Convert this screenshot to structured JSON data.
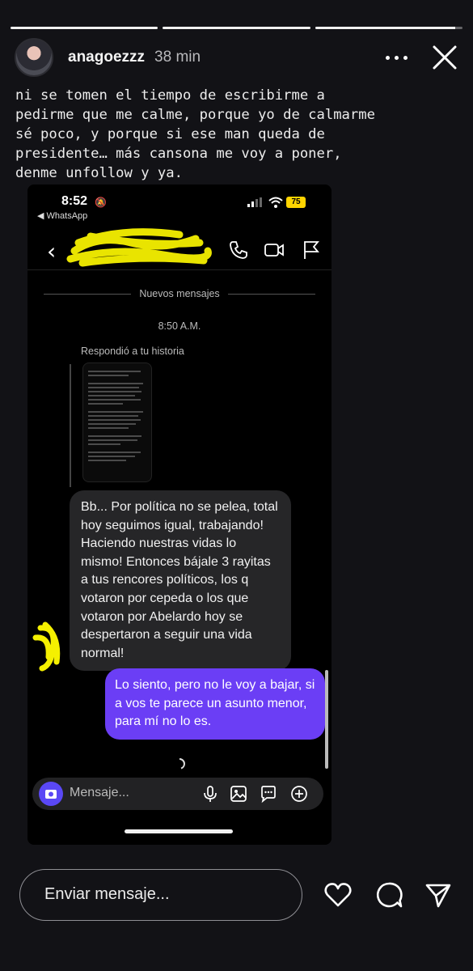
{
  "story": {
    "username": "anagoezzz",
    "time": "38 min",
    "progress": [
      1,
      1,
      0.95
    ],
    "caption": "ni se tomen el tiempo de escribirme a\npedirme que me calme, porque yo de calmarme\nsé poco, y porque si ese man queda de\npresidente… más cansona me voy a poner,\ndenme unfollow y ya."
  },
  "screenshot": {
    "status": {
      "time": "8:52",
      "back_app": "◀ WhatsApp",
      "battery": "75"
    },
    "chat": {
      "new_messages_label": "Nuevos mensajes",
      "timestamp": "8:50 A.M.",
      "replied_label": "Respondió a tu historia",
      "incoming_message": "Bb... Por política no se pelea, total hoy seguimos igual, trabajando! Haciendo nuestras vidas lo mismo! Entonces bájale 3 rayitas a tus rencores políticos, los q votaron por cepeda o los que votaron por Abelardo hoy se despertaron a seguir una vida normal!",
      "outgoing_message": "Lo siento, pero no le voy a bajar, si a vos te parece un asunto menor, para mí no lo es."
    },
    "composer": {
      "placeholder": "Mensaje..."
    }
  },
  "reply": {
    "placeholder": "Enviar mensaje..."
  },
  "colors": {
    "accent": "#6b3ef5",
    "highlighter": "#f5f000"
  }
}
